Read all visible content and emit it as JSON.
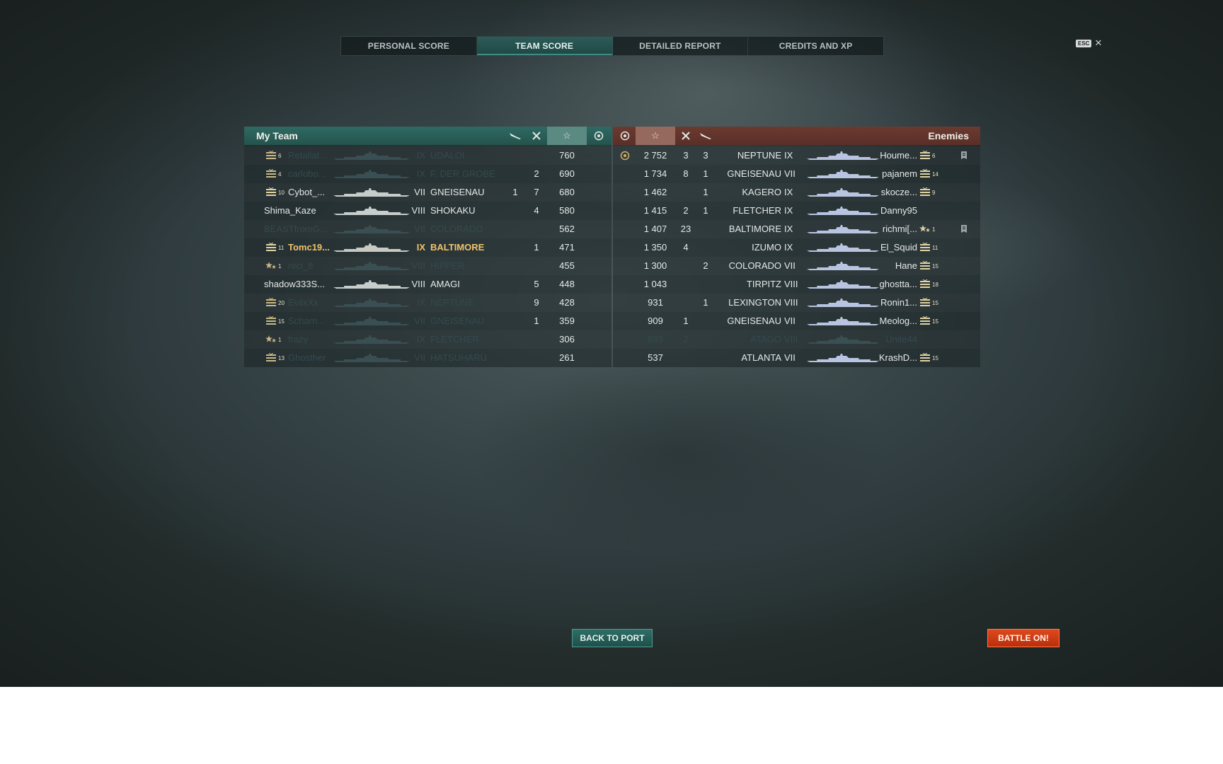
{
  "tabs": [
    {
      "label": "PERSONAL SCORE",
      "active": false
    },
    {
      "label": "TEAM SCORE",
      "active": true
    },
    {
      "label": "DETAILED REPORT",
      "active": false
    },
    {
      "label": "CREDITS AND XP",
      "active": false
    }
  ],
  "esc": {
    "key": "ESC",
    "icon": "close-icon"
  },
  "my_team": {
    "title": "My Team",
    "columns": [
      "plane-icon",
      "kills-icon",
      "star-icon",
      "base-capture-icon"
    ],
    "rows": [
      {
        "rank_icon": "rank-insignia",
        "rank": "6",
        "name": "Retaliat...",
        "tier": "IX",
        "ship": "UDALOI",
        "planes": "",
        "kills": "",
        "score": "760",
        "dead": true,
        "me": false
      },
      {
        "rank_icon": "rank-insignia",
        "rank": "4",
        "name": "carlobo...",
        "tier": "IX",
        "ship": "F. DER GROBE",
        "planes": "",
        "kills": "2",
        "score": "690",
        "dead": true,
        "me": false
      },
      {
        "rank_icon": "rank-insignia",
        "rank": "10",
        "name": "Cybot_...",
        "tier": "VII",
        "ship": "GNEISENAU",
        "planes": "1",
        "kills": "7",
        "score": "680",
        "dead": false,
        "me": false
      },
      {
        "rank_icon": "",
        "rank": "",
        "name": "Shima_Kaze",
        "tier": "VIII",
        "ship": "SHOKAKU",
        "planes": "",
        "kills": "4",
        "score": "580",
        "dead": false,
        "me": false
      },
      {
        "rank_icon": "",
        "rank": "",
        "name": "BEASTfromG...",
        "tier": "VII",
        "ship": "COLORADO",
        "planes": "",
        "kills": "",
        "score": "562",
        "dead": true,
        "me": false
      },
      {
        "rank_icon": "rank-insignia",
        "rank": "11",
        "name": "Tomc19...",
        "tier": "IX",
        "ship": "BALTIMORE",
        "planes": "",
        "kills": "1",
        "score": "471",
        "dead": false,
        "me": true
      },
      {
        "rank_icon": "rank-stars",
        "rank": "1",
        "name": "reci_8",
        "tier": "VIII",
        "ship": "HIPPER",
        "planes": "",
        "kills": "",
        "score": "455",
        "dead": true,
        "me": false
      },
      {
        "rank_icon": "",
        "rank": "",
        "name": "shadow333S...",
        "tier": "VIII",
        "ship": "AMAGI",
        "planes": "",
        "kills": "5",
        "score": "448",
        "dead": false,
        "me": false
      },
      {
        "rank_icon": "rank-insignia",
        "rank": "20",
        "name": "EvilxXx",
        "tier": "IX",
        "ship": "NEPTUNE",
        "planes": "",
        "kills": "9",
        "score": "428",
        "dead": true,
        "me": false
      },
      {
        "rank_icon": "rank-insignia",
        "rank": "15",
        "name": "Scharn...",
        "tier": "VII",
        "ship": "GNEISENAU",
        "planes": "",
        "kills": "1",
        "score": "359",
        "dead": true,
        "me": false
      },
      {
        "rank_icon": "rank-stars",
        "rank": "1",
        "name": "frazy",
        "tier": "IX",
        "ship": "FLETCHER",
        "planes": "",
        "kills": "",
        "score": "306",
        "dead": true,
        "me": false
      },
      {
        "rank_icon": "rank-insignia",
        "rank": "13",
        "name": "Ghosther",
        "tier": "VII",
        "ship": "HATSUHARU",
        "planes": "",
        "kills": "",
        "score": "261",
        "dead": true,
        "me": false
      }
    ]
  },
  "enemies": {
    "title": "Enemies",
    "rows": [
      {
        "cap": true,
        "score": "2 752",
        "kills": "3",
        "planes": "3",
        "ship": "NEPTUNE",
        "tier": "IX",
        "name": "Houme...",
        "rank_icon": "rank-insignia",
        "rank": "6",
        "report": true,
        "dead": false
      },
      {
        "cap": false,
        "score": "1 734",
        "kills": "8",
        "planes": "1",
        "ship": "GNEISENAU",
        "tier": "VII",
        "name": "pajanem",
        "rank_icon": "rank-insignia",
        "rank": "14",
        "report": false,
        "dead": false
      },
      {
        "cap": false,
        "score": "1 462",
        "kills": "",
        "planes": "1",
        "ship": "KAGERO",
        "tier": "IX",
        "name": "skocze...",
        "rank_icon": "rank-insignia",
        "rank": "9",
        "report": false,
        "dead": false
      },
      {
        "cap": false,
        "score": "1 415",
        "kills": "2",
        "planes": "1",
        "ship": "FLETCHER",
        "tier": "IX",
        "name": "Danny95",
        "rank_icon": "",
        "rank": "",
        "report": false,
        "dead": false
      },
      {
        "cap": false,
        "score": "1 407",
        "kills": "23",
        "planes": "",
        "ship": "BALTIMORE",
        "tier": "IX",
        "name": "richmi[...",
        "rank_icon": "rank-stars",
        "rank": "1",
        "report": true,
        "dead": false
      },
      {
        "cap": false,
        "score": "1 350",
        "kills": "4",
        "planes": "",
        "ship": "IZUMO",
        "tier": "IX",
        "name": "El_Squid",
        "rank_icon": "rank-insignia",
        "rank": "11",
        "report": false,
        "dead": false
      },
      {
        "cap": false,
        "score": "1 300",
        "kills": "",
        "planes": "2",
        "ship": "COLORADO",
        "tier": "VII",
        "name": "Hane",
        "rank_icon": "rank-insignia",
        "rank": "15",
        "report": false,
        "dead": false
      },
      {
        "cap": false,
        "score": "1 043",
        "kills": "",
        "planes": "",
        "ship": "TIRPITZ",
        "tier": "VIII",
        "name": "ghostta...",
        "rank_icon": "rank-insignia",
        "rank": "18",
        "report": false,
        "dead": false
      },
      {
        "cap": false,
        "score": "931",
        "kills": "",
        "planes": "1",
        "ship": "LEXINGTON",
        "tier": "VIII",
        "name": "Ronin1...",
        "rank_icon": "rank-insignia",
        "rank": "15",
        "report": false,
        "dead": false
      },
      {
        "cap": false,
        "score": "909",
        "kills": "1",
        "planes": "",
        "ship": "GNEISENAU",
        "tier": "VII",
        "name": "Meolog...",
        "rank_icon": "rank-insignia",
        "rank": "15",
        "report": false,
        "dead": false
      },
      {
        "cap": false,
        "score": "893",
        "kills": "2",
        "planes": "",
        "ship": "ATAGO",
        "tier": "VIII",
        "name": "Unite44",
        "rank_icon": "",
        "rank": "",
        "report": false,
        "dead": true
      },
      {
        "cap": false,
        "score": "537",
        "kills": "",
        "planes": "",
        "ship": "ATLANTA",
        "tier": "VII",
        "name": "KrashD...",
        "rank_icon": "rank-insignia",
        "rank": "15",
        "report": false,
        "dead": false
      }
    ]
  },
  "buttons": {
    "back_to_port": "BACK TO PORT",
    "battle_on": "BATTLE ON!"
  },
  "colors": {
    "my_team": "#2f6a62",
    "enemies": "#6b3a30",
    "player_highlight": "#f2c46a",
    "battle_button": "#e0481c"
  }
}
